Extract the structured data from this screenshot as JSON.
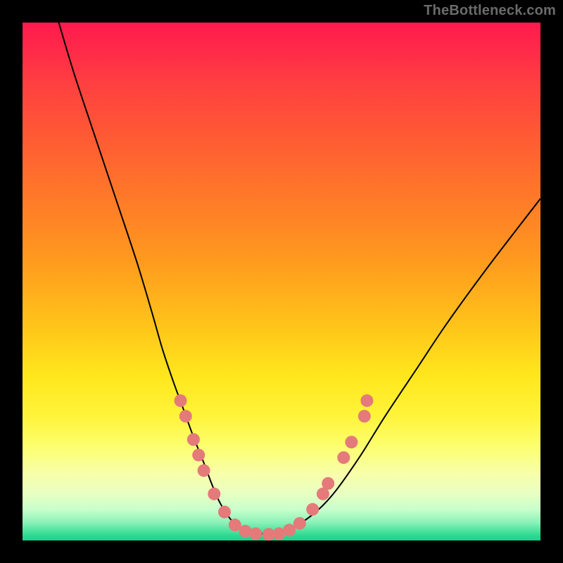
{
  "watermark": "TheBottleneck.com",
  "colors": {
    "frame": "#000000",
    "curve": "#000000",
    "dots": "#e47a7a",
    "gradient_stops": [
      "#ff1a4d",
      "#ff4040",
      "#ff9a1e",
      "#ffe61c",
      "#fcff70",
      "#c8ffcc",
      "#18d38b"
    ]
  },
  "chart_data": {
    "type": "line",
    "title": "",
    "xlabel": "",
    "ylabel": "",
    "xlim": [
      0,
      100
    ],
    "ylim": [
      0,
      100
    ],
    "grid": false,
    "legend": false,
    "series": [
      {
        "name": "bottleneck-curve",
        "x": [
          7,
          10,
          14,
          18,
          22,
          25,
          27,
          29,
          31,
          33,
          35,
          36.5,
          38,
          39.5,
          41,
          43,
          45,
          48,
          50,
          52,
          56,
          60,
          65,
          70,
          76,
          82,
          90,
          100
        ],
        "y": [
          100,
          90,
          78,
          66,
          54,
          44,
          37,
          31,
          25.5,
          20,
          15,
          11,
          7.5,
          5,
          3.2,
          2.1,
          1.5,
          1.2,
          1.4,
          2.3,
          5,
          9,
          16,
          24,
          33,
          42,
          53,
          66
        ]
      }
    ],
    "scatter": {
      "name": "highlighted-points",
      "points": [
        {
          "x": 30.5,
          "y": 27
        },
        {
          "x": 31.5,
          "y": 24
        },
        {
          "x": 33,
          "y": 19.5
        },
        {
          "x": 34,
          "y": 16.5
        },
        {
          "x": 35,
          "y": 13.5
        },
        {
          "x": 37,
          "y": 9
        },
        {
          "x": 39,
          "y": 5.5
        },
        {
          "x": 41,
          "y": 3
        },
        {
          "x": 43,
          "y": 1.8
        },
        {
          "x": 45,
          "y": 1.3
        },
        {
          "x": 47.5,
          "y": 1.2
        },
        {
          "x": 49.5,
          "y": 1.3
        },
        {
          "x": 51.5,
          "y": 2
        },
        {
          "x": 53.5,
          "y": 3.3
        },
        {
          "x": 56,
          "y": 6
        },
        {
          "x": 58,
          "y": 9
        },
        {
          "x": 59,
          "y": 11
        },
        {
          "x": 62,
          "y": 16
        },
        {
          "x": 63.5,
          "y": 19
        },
        {
          "x": 66,
          "y": 24
        },
        {
          "x": 66.5,
          "y": 27
        }
      ]
    }
  }
}
